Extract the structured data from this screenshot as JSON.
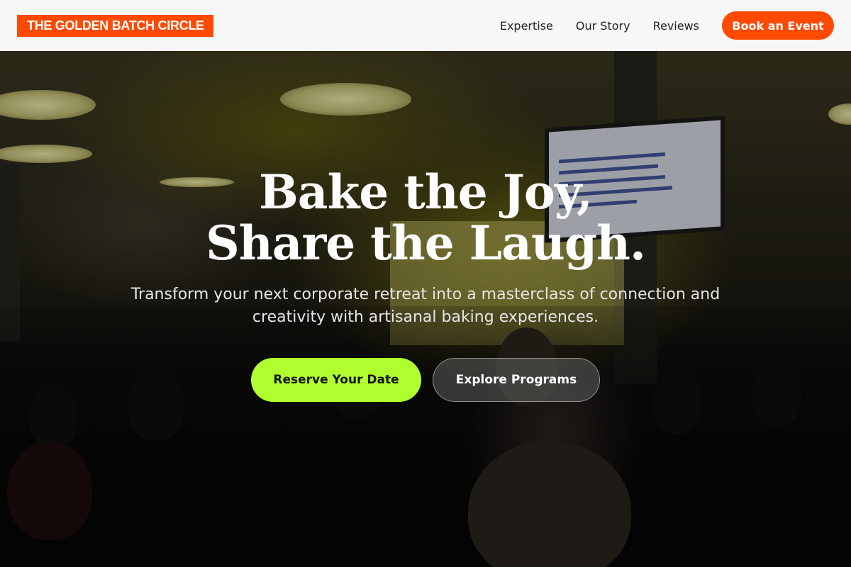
{
  "nav": {
    "brand": "THE GOLDEN BATCH CIRCLE",
    "links": [
      "Expertise",
      "Our Story",
      "Reviews"
    ],
    "cta": "Book an Event"
  },
  "hero": {
    "headline_line1": "Bake the Joy,",
    "headline_line2": "Share the Laugh.",
    "subtitle": "Transform your next corporate retreat into a masterclass of connection and creativity with artisanal baking experiences.",
    "primary_button": "Reserve Your Date",
    "secondary_button": "Explore Programs"
  },
  "colors": {
    "brand_orange": "#ff4a00",
    "primary_lime": "#b0ff2e",
    "nav_bg": "#f7f7f7"
  }
}
